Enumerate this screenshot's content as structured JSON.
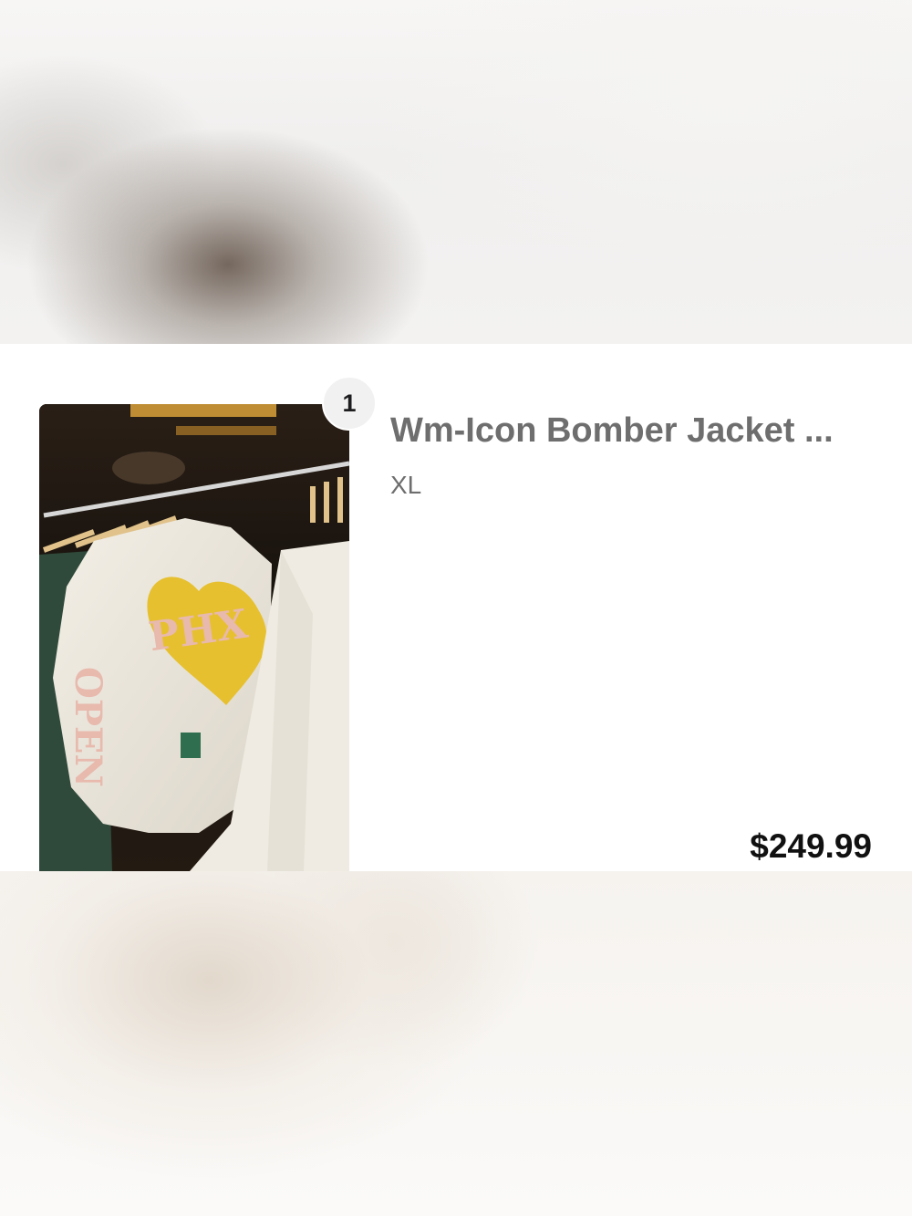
{
  "cart_item": {
    "quantity": "1",
    "title": "Wm-Icon Bomber Jacket ...",
    "variant": "XL",
    "price": "$249.99",
    "image_icon": "product-photo-icon"
  },
  "colors": {
    "title_text": "#6e6e6e",
    "price_text": "#111111",
    "badge_bg": "#f1f1f1"
  }
}
